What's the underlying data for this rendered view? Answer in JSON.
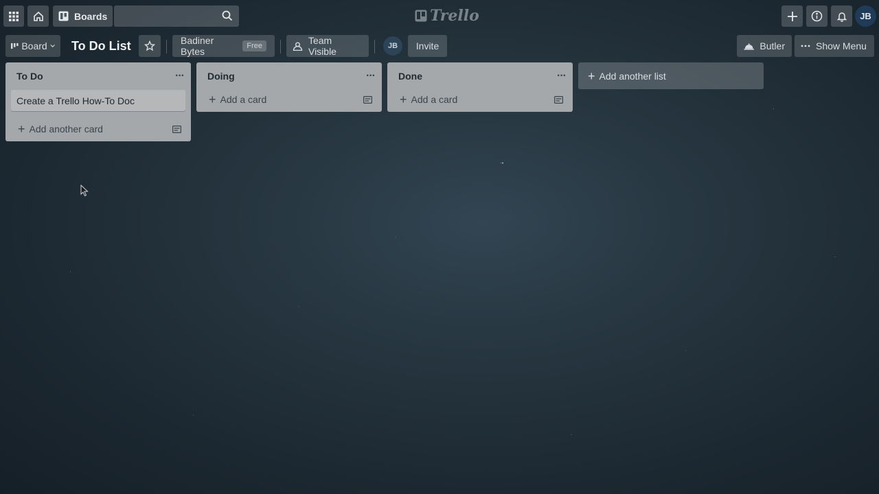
{
  "nav": {
    "boards_label": "Boards",
    "search_placeholder": "",
    "logo_text": "Trello",
    "user_initials": "JB"
  },
  "board_header": {
    "view_label": "Board",
    "title": "To Do List",
    "team_name": "Badiner Bytes",
    "plan_badge": "Free",
    "visibility_label": "Team Visible",
    "member_initials": "JB",
    "invite_label": "Invite",
    "butler_label": "Butler",
    "show_menu_label": "Show Menu"
  },
  "lists": [
    {
      "title": "To Do",
      "cards": [
        "Create a Trello How-To Doc"
      ],
      "add_card_label": "Add another card"
    },
    {
      "title": "Doing",
      "cards": [],
      "add_card_label": "Add a card"
    },
    {
      "title": "Done",
      "cards": [],
      "add_card_label": "Add a card"
    }
  ],
  "add_list_label": "Add another list",
  "colors": {
    "list_bg": "#a5a8aa",
    "card_bg": "#b5b7b8",
    "board_bg": "#26353f"
  }
}
